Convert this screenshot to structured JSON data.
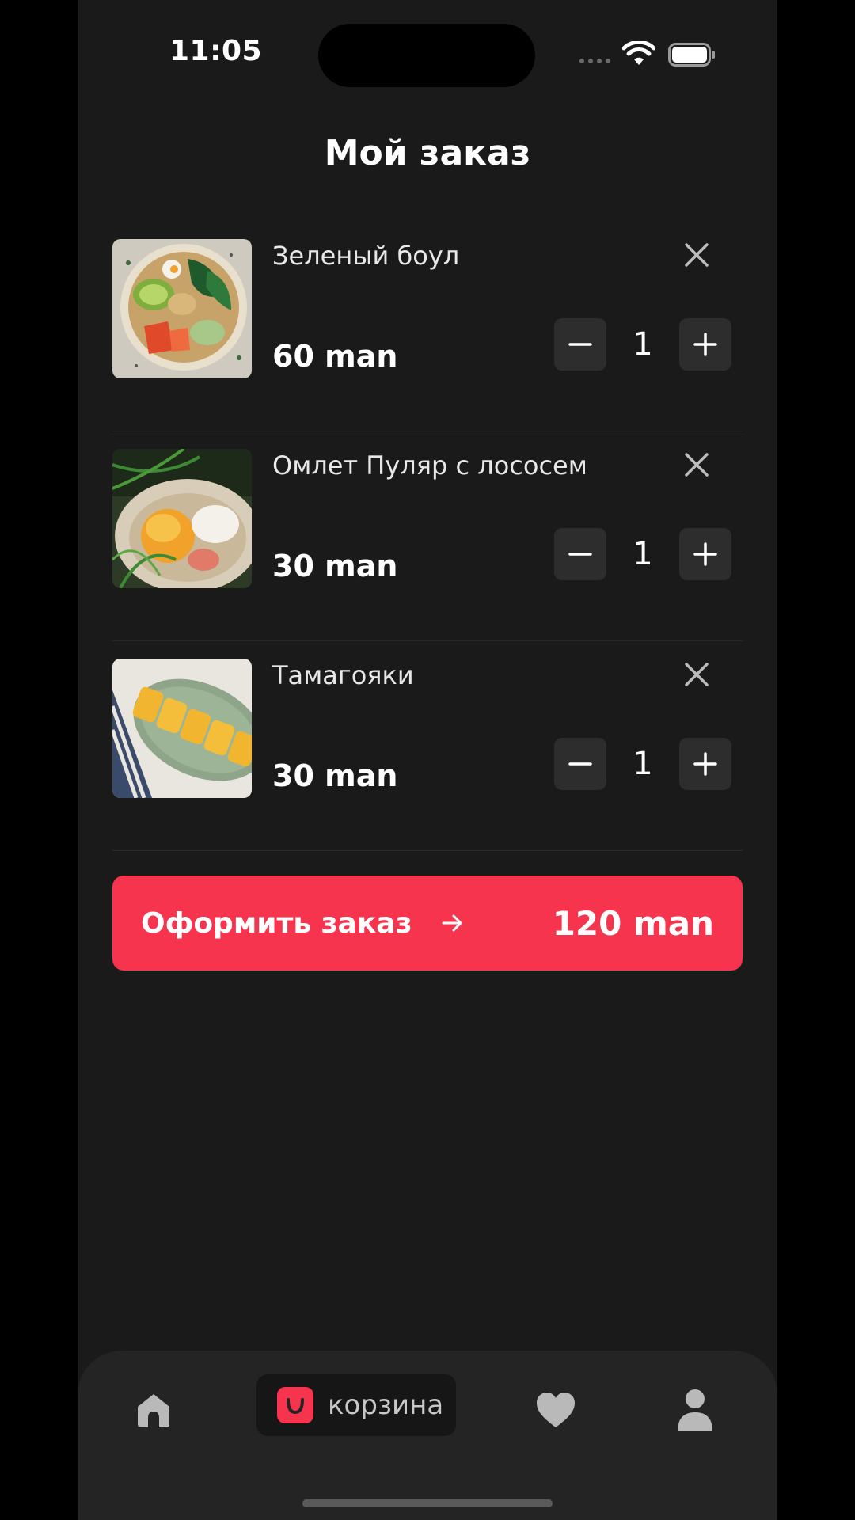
{
  "status_bar": {
    "time": "11:05"
  },
  "page": {
    "title": "Мой заказ"
  },
  "order_items": [
    {
      "name": "Зеленый боул",
      "price": "60 man",
      "quantity": "1",
      "image": "green-bowl-photo"
    },
    {
      "name": "Омлет Пуляр с лососем",
      "price": "30 man",
      "quantity": "1",
      "image": "omelette-salmon-photo"
    },
    {
      "name": "Тамагояки",
      "price": "30 man",
      "quantity": "1",
      "image": "tamagoyaki-photo"
    }
  ],
  "checkout": {
    "label": "Оформить заказ",
    "total": "120 man"
  },
  "tab_bar": {
    "items": [
      {
        "icon": "home-icon",
        "active": false
      },
      {
        "icon": "cart-icon",
        "label": "корзина",
        "active": true
      },
      {
        "icon": "heart-icon",
        "active": false
      },
      {
        "icon": "profile-icon",
        "active": false
      }
    ]
  },
  "colors": {
    "accent": "#f7344d",
    "background": "#1a1a1a",
    "nav_background": "#242424",
    "control": "#2d2d2d"
  }
}
